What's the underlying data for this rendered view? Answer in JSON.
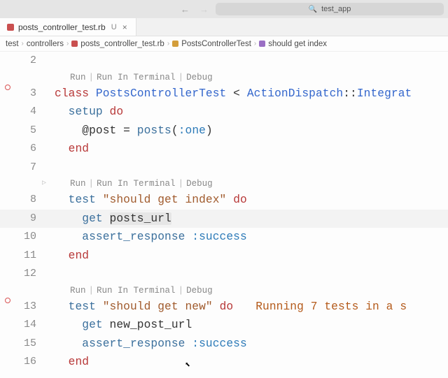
{
  "titlebar": {
    "search_label": "test_app"
  },
  "tab": {
    "filename": "posts_controller_test.rb",
    "vcs_status": "U",
    "close": "×"
  },
  "breadcrumb": {
    "seg1": "test",
    "seg2": "controllers",
    "seg3": "posts_controller_test.rb",
    "seg4": "PostsControllerTest",
    "seg5": "should get index"
  },
  "codelens": {
    "run": "Run",
    "run_terminal": "Run In Terminal",
    "debug": "Debug",
    "sep": "|"
  },
  "lines": {
    "l2": {
      "n": "2",
      "code": ""
    },
    "l3": {
      "n": "3",
      "kw_class": "class ",
      "cls1": "PostsControllerTest",
      "op_lt": " < ",
      "cls2": "ActionDispatch",
      "op_cc": "::",
      "cls3": "Integrat"
    },
    "l4": {
      "n": "4",
      "pad": "  ",
      "fn": "setup ",
      "kw_do": "do"
    },
    "l5": {
      "n": "5",
      "pad": "    ",
      "ivar": "@post",
      "op_eq": " = ",
      "fn": "posts",
      "p_open": "(",
      "sym": ":one",
      "p_close": ")"
    },
    "l6": {
      "n": "6",
      "pad": "  ",
      "kw_end": "end"
    },
    "l7": {
      "n": "7",
      "code": ""
    },
    "l8": {
      "n": "8",
      "pad": "  ",
      "fn_test": "test ",
      "str": "\"should get index\"",
      "sp": " ",
      "kw_do": "do"
    },
    "l9": {
      "n": "9",
      "pad": "    ",
      "fn_get": "get ",
      "url": "posts_url"
    },
    "l10": {
      "n": "10",
      "pad": "    ",
      "fn_assert": "assert_response ",
      "sym": ":success"
    },
    "l11": {
      "n": "11",
      "pad": "  ",
      "kw_end": "end"
    },
    "l12": {
      "n": "12",
      "code": ""
    },
    "l13": {
      "n": "13",
      "pad": "  ",
      "fn_test": "test ",
      "str": "\"should get new\"",
      "sp": " ",
      "kw_do": "do",
      "status": "Running 7 tests in a s"
    },
    "l14": {
      "n": "14",
      "pad": "    ",
      "fn_get": "get ",
      "url": "new_post_url"
    },
    "l15": {
      "n": "15",
      "pad": "    ",
      "fn_assert": "assert_response ",
      "sym": ":success"
    },
    "l16": {
      "n": "16",
      "pad": "  ",
      "kw_end": "end"
    }
  }
}
